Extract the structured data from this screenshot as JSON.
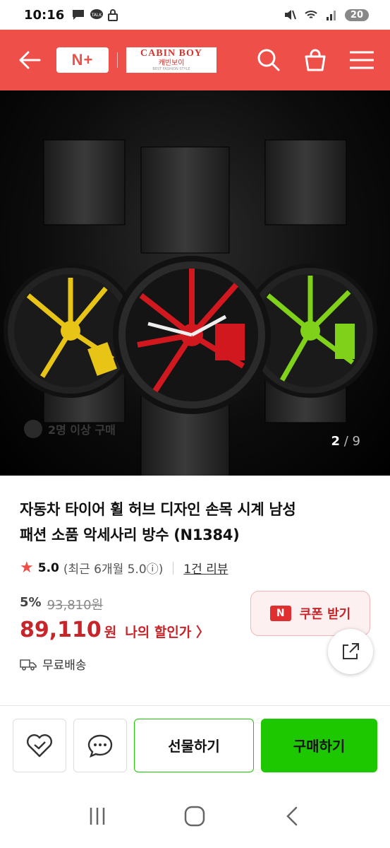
{
  "status_bar": {
    "time": "10:16",
    "battery": "20"
  },
  "header": {
    "logo_text": "N+",
    "brand_line1": "CABIN BOY",
    "brand_line2": "캐빈보이",
    "brand_line3": "BEST FASHION STYLE",
    "accent_color": "#ee4f48"
  },
  "hero": {
    "buyer_badge": "2명 이상 구매",
    "pager_current": "2",
    "pager_sep": "/",
    "pager_total": "9",
    "watch_colors": [
      "#e8c416",
      "#d1181e",
      "#7fd11a"
    ]
  },
  "product": {
    "title_line1": "자동차 타이어 휠 허브 디자인 손목 시계 남성",
    "title_line2": "패션 소품 악세사리 방수 (N1384)",
    "rating": "5.0",
    "recent_rating": "(최근 6개월 5.0ⓘ)",
    "review_count": "1건 리뷰"
  },
  "price": {
    "discount_pct": "5%",
    "original_price": "93,810원",
    "sale_price": "89,110",
    "currency": "원",
    "my_discount": "나의 할인가 〉",
    "coupon_label": "쿠폰 받기",
    "coupon_icon_text": "N",
    "shipping": "무료배송"
  },
  "bottom_bar": {
    "gift_label": "선물하기",
    "buy_label": "구매하기",
    "buy_color": "#1ec800"
  }
}
